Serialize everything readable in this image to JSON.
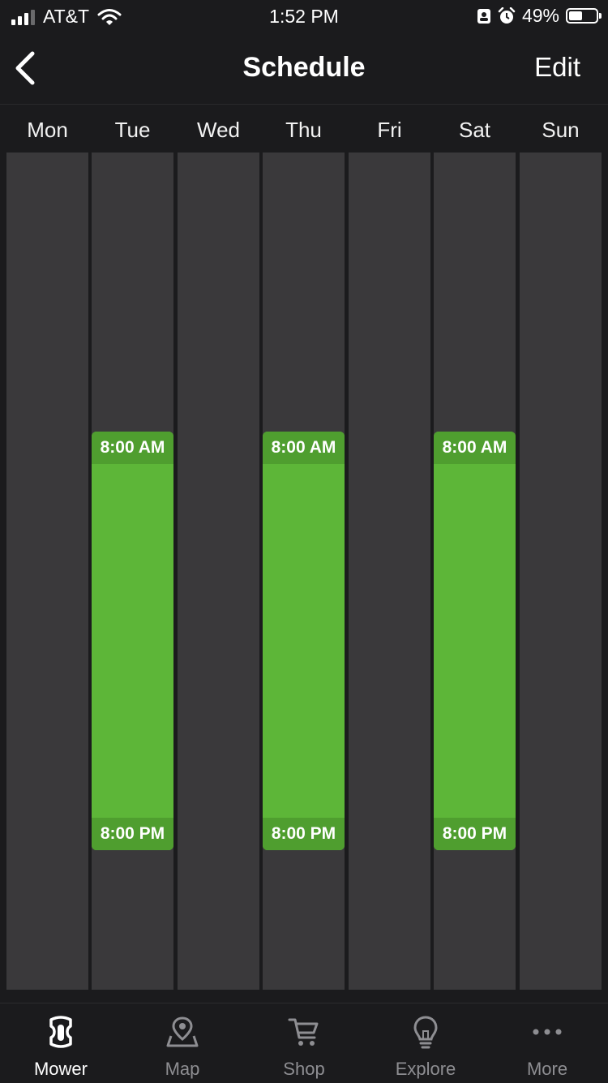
{
  "status_bar": {
    "carrier": "AT&T",
    "time": "1:52 PM",
    "battery_percent": "49%",
    "battery_level": 0.49
  },
  "nav": {
    "title": "Schedule",
    "edit_label": "Edit"
  },
  "days": [
    "Mon",
    "Tue",
    "Wed",
    "Thu",
    "Fri",
    "Sat",
    "Sun"
  ],
  "schedule": [
    {
      "day": "Tue",
      "start": "8:00 AM",
      "end": "8:00 PM"
    },
    {
      "day": "Thu",
      "start": "8:00 AM",
      "end": "8:00 PM"
    },
    {
      "day": "Sat",
      "start": "8:00 AM",
      "end": "8:00 PM"
    }
  ],
  "tabs": [
    {
      "label": "Mower",
      "icon": "mower-icon",
      "active": true
    },
    {
      "label": "Map",
      "icon": "map-pin-icon",
      "active": false
    },
    {
      "label": "Shop",
      "icon": "cart-icon",
      "active": false
    },
    {
      "label": "Explore",
      "icon": "lightbulb-icon",
      "active": false
    },
    {
      "label": "More",
      "icon": "more-dots-icon",
      "active": false
    }
  ],
  "colors": {
    "background": "#1b1b1d",
    "day_column": "#3a393b",
    "block": "#5db638",
    "block_header": "#4f9e2f",
    "tab_inactive": "#8e8e92"
  }
}
